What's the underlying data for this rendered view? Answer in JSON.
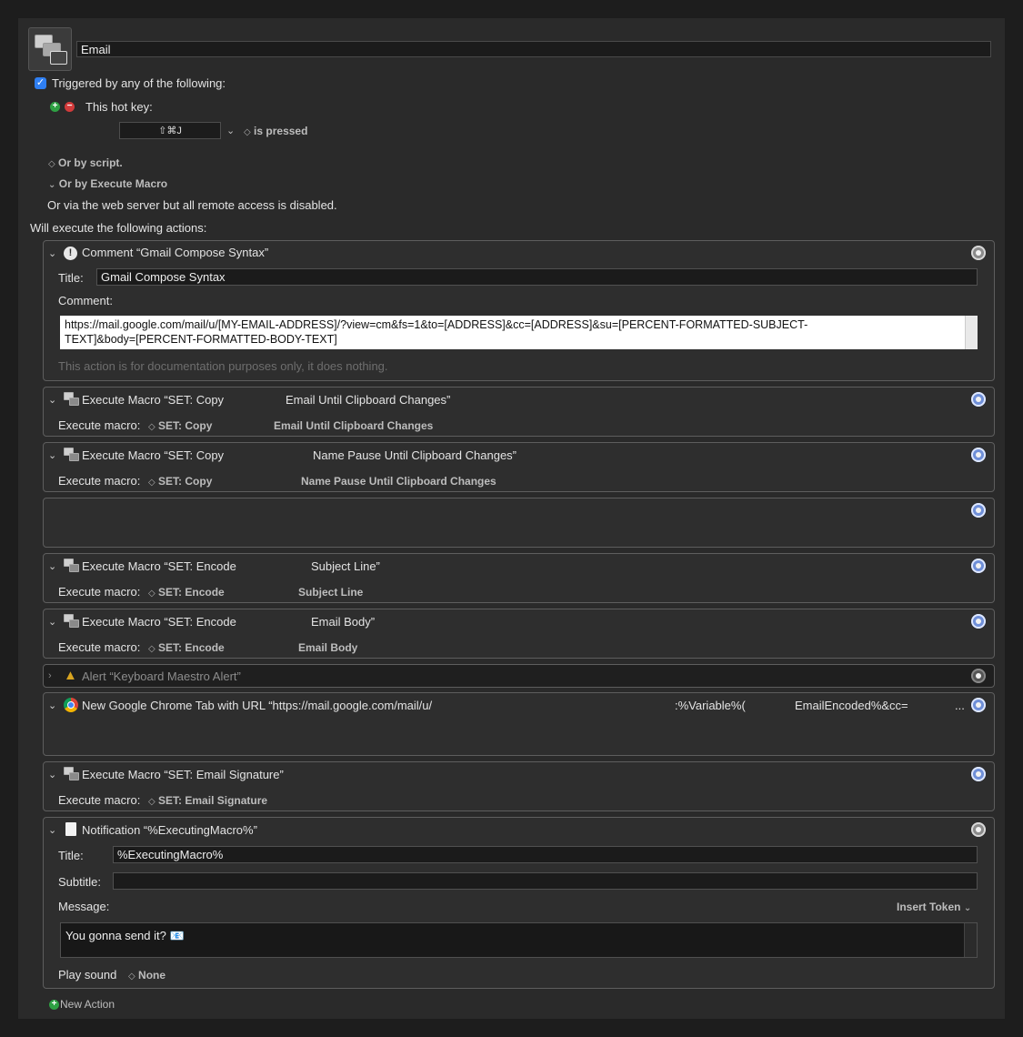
{
  "macro": {
    "name": "Email",
    "triggered_label": "Triggered by any of the following:",
    "hotkey_label": "This hot key:",
    "hotkey_value": "⇧⌘J",
    "hotkey_state": "is pressed",
    "or_by_script": "Or by script.",
    "or_by_execute": "Or by Execute Macro",
    "web_server": "Or via the web server but all remote access is disabled.",
    "will_execute": "Will execute the following actions:"
  },
  "comment_action": {
    "header": "Comment “Gmail Compose Syntax”",
    "title_label": "Title:",
    "title_value": "Gmail Compose Syntax",
    "comment_label": "Comment:",
    "comment_line1": "https://mail.google.com/mail/u/[MY-EMAIL-ADDRESS]/?view=cm&fs=1&to=[ADDRESS]&cc=[ADDRESS]&su=[PERCENT-FORMATTED-SUBJECT-",
    "comment_line2": "TEXT]&body=[PERCENT-FORMATTED-BODY-TEXT]",
    "note": "This action is for documentation purposes only, it does nothing."
  },
  "exec1": {
    "header_a": "Execute Macro “SET: Copy",
    "header_b": "Email Until Clipboard Changes”",
    "label": "Execute macro:",
    "value_a": "SET: Copy",
    "value_b": "Email Until Clipboard Changes"
  },
  "exec2": {
    "header_a": "Execute Macro “SET: Copy",
    "header_b": "Name Pause Until Clipboard Changes”",
    "label": "Execute macro:",
    "value_a": "SET: Copy",
    "value_b": "Name Pause Until Clipboard Changes"
  },
  "exec3": {
    "header_a": "Execute Macro “SET: Encode",
    "header_b": "Subject Line”",
    "label": "Execute macro:",
    "value_a": "SET: Encode",
    "value_b": "Subject Line"
  },
  "exec4": {
    "header_a": "Execute Macro “SET: Encode",
    "header_b": "Email Body”",
    "label": "Execute macro:",
    "value_a": "SET: Encode",
    "value_b": "Email Body"
  },
  "alert_action": {
    "header": "Alert “Keyboard Maestro Alert”"
  },
  "chrome_action": {
    "header": "New Google Chrome Tab with URL “https://mail.google.com/mail/u/",
    "mid": ":%Variable%(",
    "tail": "EmailEncoded%&cc=",
    "ellipsis": "..."
  },
  "exec5": {
    "header": "Execute Macro “SET: Email Signature”",
    "label": "Execute macro:",
    "value": "SET: Email Signature"
  },
  "notification": {
    "header": "Notification “%ExecutingMacro%”",
    "title_label": "Title:",
    "title_value": "%ExecutingMacro%",
    "subtitle_label": "Subtitle:",
    "subtitle_value": "",
    "message_label": "Message:",
    "insert_token": "Insert Token",
    "message_value": "You gonna send it? 📧",
    "sound_label": "Play sound",
    "sound_value": "None"
  },
  "footer": {
    "new_action": "New Action"
  },
  "colors": {
    "accent": "#2f7ff2",
    "add": "#2ea043",
    "remove": "#d23b3b"
  }
}
